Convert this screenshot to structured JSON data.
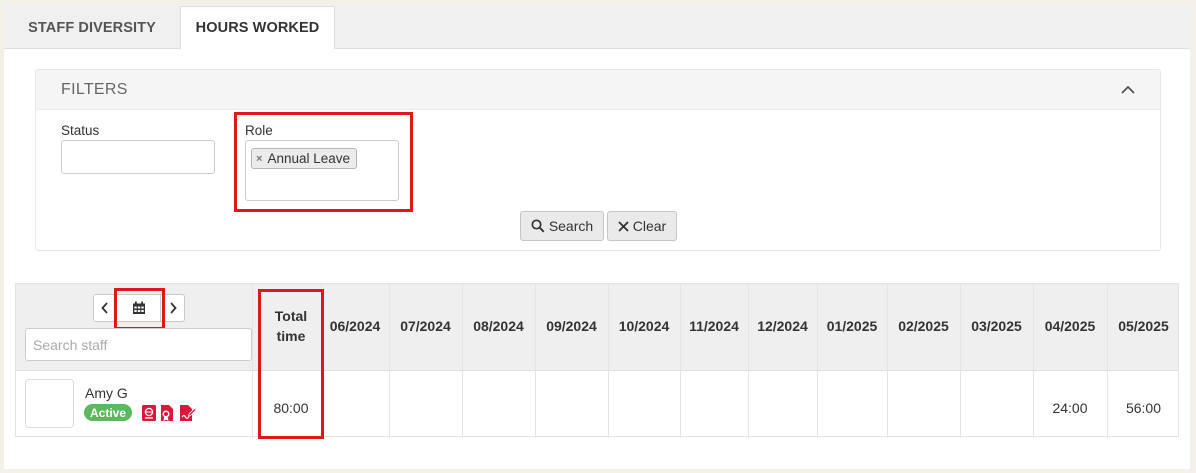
{
  "tabs": [
    {
      "label": "STAFF DIVERSITY",
      "active": false
    },
    {
      "label": "HOURS WORKED",
      "active": true
    }
  ],
  "filters": {
    "title": "FILTERS",
    "status_label": "Status",
    "role_label": "Role",
    "role_selected": "Annual Leave",
    "search_button": "Search",
    "clear_button": "Clear"
  },
  "grid": {
    "search_placeholder": "Search staff",
    "total_header_line1": "Total",
    "total_header_line2": "time",
    "months": [
      "06/2024",
      "07/2024",
      "08/2024",
      "09/2024",
      "10/2024",
      "11/2024",
      "12/2024",
      "01/2025",
      "02/2025",
      "03/2025",
      "04/2025",
      "05/2025"
    ],
    "rows": [
      {
        "name": "Amy G",
        "status": "Active",
        "total": "80:00",
        "values": [
          "",
          "",
          "",
          "",
          "",
          "",
          "",
          "",
          "",
          "",
          "24:00",
          "56:00"
        ]
      }
    ]
  },
  "colors": {
    "highlight": "#e0161d",
    "active_badge": "#5cb85c",
    "icon_red": "#d9183b"
  }
}
